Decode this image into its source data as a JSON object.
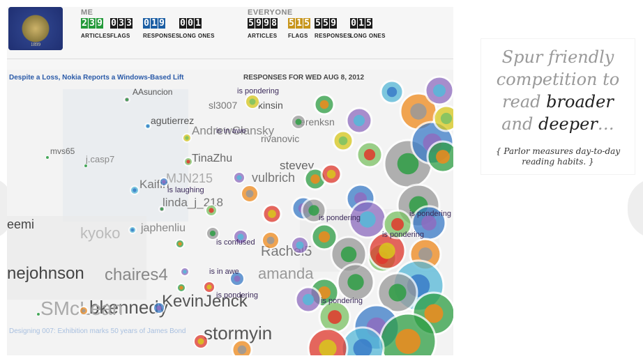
{
  "me": {
    "title": "ME",
    "stats": [
      {
        "digits": "239",
        "label": "ARTICLES",
        "style": "green"
      },
      {
        "digits": "033",
        "label": "FLAGS",
        "style": "black"
      },
      {
        "digits": "019",
        "label": "RESPONSES",
        "style": "blue"
      },
      {
        "digits": "001",
        "label": "LONG ONES",
        "style": "black"
      }
    ]
  },
  "everyone": {
    "title": "EVERYONE",
    "stats": [
      {
        "digits": "5998",
        "label": "ARTICLES",
        "style": "black"
      },
      {
        "digits": "515",
        "label": "FLAGS",
        "style": "gold"
      },
      {
        "digits": "559",
        "label": "RESPONSES",
        "style": "black"
      },
      {
        "digits": "015",
        "label": "LONG ONES",
        "style": "black"
      }
    ]
  },
  "seal": {
    "year": "1899"
  },
  "article_link": "Despite a Loss, Nokia Reports a Windows-Based Lift",
  "responses_title": "RESPONSES FOR WED AUG 8, 2012",
  "background_article": "Designing 007: Exhibition marks 50 years of James Bond",
  "sidebar": {
    "headline_lead": "Spur friendly competition to read",
    "headline_em1": "broader",
    "headline_mid": "and",
    "headline_em2": "deeper",
    "headline_tail": "…",
    "subtitle": "{ Parlor measures day-to-day reading habits. }"
  },
  "users": [
    {
      "name": "AAsuncion",
      "size": 12,
      "color": "#555555"
    },
    {
      "name": "agutierrez",
      "size": 14,
      "color": "#555555"
    },
    {
      "name": "mvs65",
      "size": 12,
      "color": "#666666"
    },
    {
      "name": "j.casp7",
      "size": 13,
      "color": "#8a8a8a"
    },
    {
      "name": "AndrewClansky",
      "size": 17,
      "color": "#888888"
    },
    {
      "name": "TinaZhu",
      "size": 16,
      "color": "#666666"
    },
    {
      "name": "MJN215",
      "size": 18,
      "color": "#aaaaaa"
    },
    {
      "name": "Kaifin",
      "size": 17,
      "color": "#777777"
    },
    {
      "name": "linda_j_218",
      "size": 17,
      "color": "#777777"
    },
    {
      "name": "japhenliu",
      "size": 16,
      "color": "#888888"
    },
    {
      "name": "kyoko",
      "size": 22,
      "color": "#bbbbbb"
    },
    {
      "name": "eemi",
      "size": 18,
      "color": "#444444"
    },
    {
      "name": "nejohnson",
      "size": 24,
      "color": "#444444"
    },
    {
      "name": "bkennedy",
      "size": 26,
      "color": "#555555"
    },
    {
      "name": "SMcLean",
      "size": 28,
      "color": "#aaaaaa"
    },
    {
      "name": "KevinJenck",
      "size": 24,
      "color": "#555555"
    },
    {
      "name": "stormyin",
      "size": 26,
      "color": "#555555"
    },
    {
      "name": "chaires4",
      "size": 24,
      "color": "#888888"
    },
    {
      "name": "kinsin",
      "size": 14,
      "color": "#555555"
    },
    {
      "name": "rivanovic",
      "size": 14,
      "color": "#777777"
    },
    {
      "name": "erenksn",
      "size": 14,
      "color": "#777777"
    },
    {
      "name": "stevey",
      "size": 17,
      "color": "#666666"
    },
    {
      "name": "vulbrich",
      "size": 18,
      "color": "#777777"
    },
    {
      "name": "Rachel5",
      "size": 20,
      "color": "#777777"
    },
    {
      "name": "sl3007",
      "size": 14,
      "color": "#777777"
    },
    {
      "name": "amanda",
      "size": 22,
      "color": "#999999"
    }
  ],
  "statuses": [
    {
      "text": "is pondering"
    },
    {
      "text": "is in awe"
    },
    {
      "text": "is laughing"
    },
    {
      "text": "is pondering"
    },
    {
      "text": "is confused"
    },
    {
      "text": "is pondering"
    },
    {
      "text": "is in awe"
    },
    {
      "text": "is pondering"
    },
    {
      "text": "is pondering"
    },
    {
      "text": "is pondering"
    }
  ],
  "bubble_colors": [
    "#2e9e44",
    "#3a7bc8",
    "#e0372c",
    "#f08a1c",
    "#8e6cc0",
    "#d8c81c",
    "#999999",
    "#55b8d8",
    "#7bc264"
  ]
}
